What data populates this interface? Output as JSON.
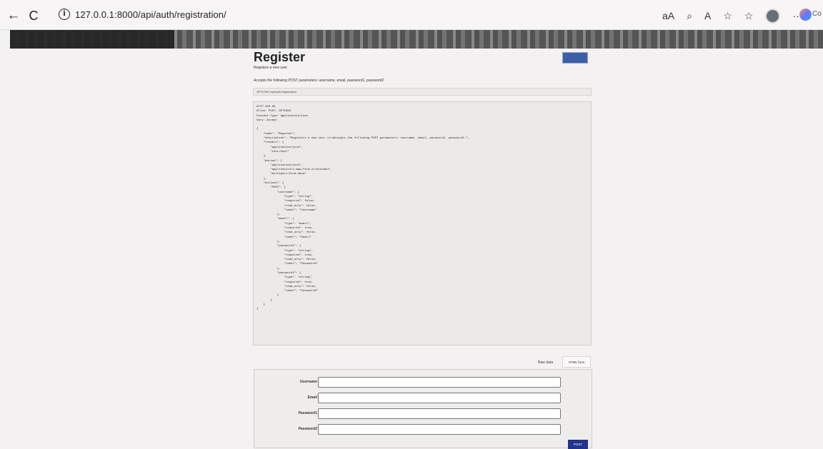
{
  "browser": {
    "url": "127.0.0.1:8000/api/auth/registration/",
    "copilot_label": "Co"
  },
  "page": {
    "title": "Register",
    "subtitle": "Registers a new user.",
    "description": "Accepts the following POST parameters: username, email, password1, password2",
    "method_line": "OPTIONS /api/auth/registration/",
    "response_text": "HTTP 200 OK\nAllow: POST, OPTIONS\nContent-Type: application/json\nVary: Accept\n\n{\n    \"name\": \"Register\",\n    \"description\": \"Registers a new user.\\n\\nAccepts the following POST parameters: username, email, password1, password2.\",\n    \"renders\": [\n        \"application/json\",\n        \"text/html\"\n    ],\n    \"parses\": [\n        \"application/json\",\n        \"application/x-www-form-urlencoded\",\n        \"multipart/form-data\"\n    ],\n    \"actions\": {\n        \"POST\": {\n            \"username\": {\n                \"type\": \"string\",\n                \"required\": false,\n                \"read_only\": false,\n                \"label\": \"Username\"\n            },\n            \"email\": {\n                \"type\": \"email\",\n                \"required\": true,\n                \"read_only\": false,\n                \"label\": \"Email\"\n            },\n            \"password1\": {\n                \"type\": \"string\",\n                \"required\": true,\n                \"read_only\": false,\n                \"label\": \"Password1\"\n            },\n            \"password2\": {\n                \"type\": \"string\",\n                \"required\": true,\n                \"read_only\": false,\n                \"label\": \"Password2\"\n            }\n        }\n    }\n}",
    "tabs": {
      "raw_data": "Raw data",
      "html_form": "HTML form"
    },
    "form": {
      "username_label": "Username",
      "email_label": "Email",
      "password1_label": "Password1",
      "password2_label": "Password2",
      "post_label": "POST"
    }
  }
}
